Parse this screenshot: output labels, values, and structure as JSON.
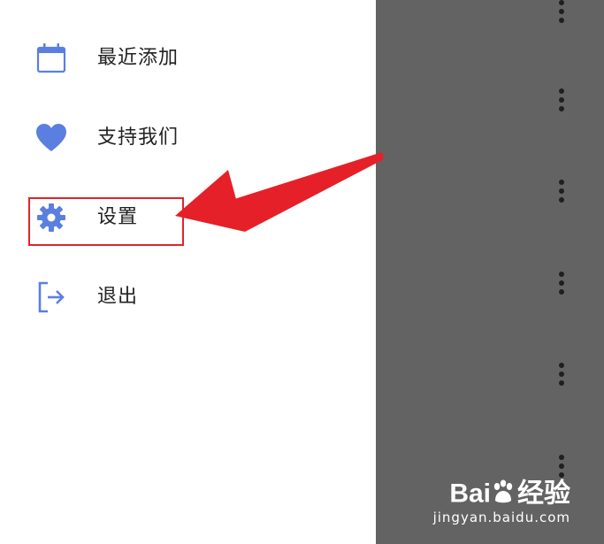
{
  "drawer": {
    "items": [
      {
        "label": "最近添加",
        "icon": "calendar-icon"
      },
      {
        "label": "支持我们",
        "icon": "heart-icon"
      },
      {
        "label": "设置",
        "icon": "gear-icon"
      },
      {
        "label": "退出",
        "icon": "logout-icon"
      }
    ]
  },
  "colors": {
    "accent": "#5b7fe0",
    "scrim": "#636363",
    "highlight": "#e0242b"
  },
  "watermark": {
    "brand_left": "Bai",
    "brand_right": "经验",
    "sub": "jingyan.baidu.com"
  }
}
